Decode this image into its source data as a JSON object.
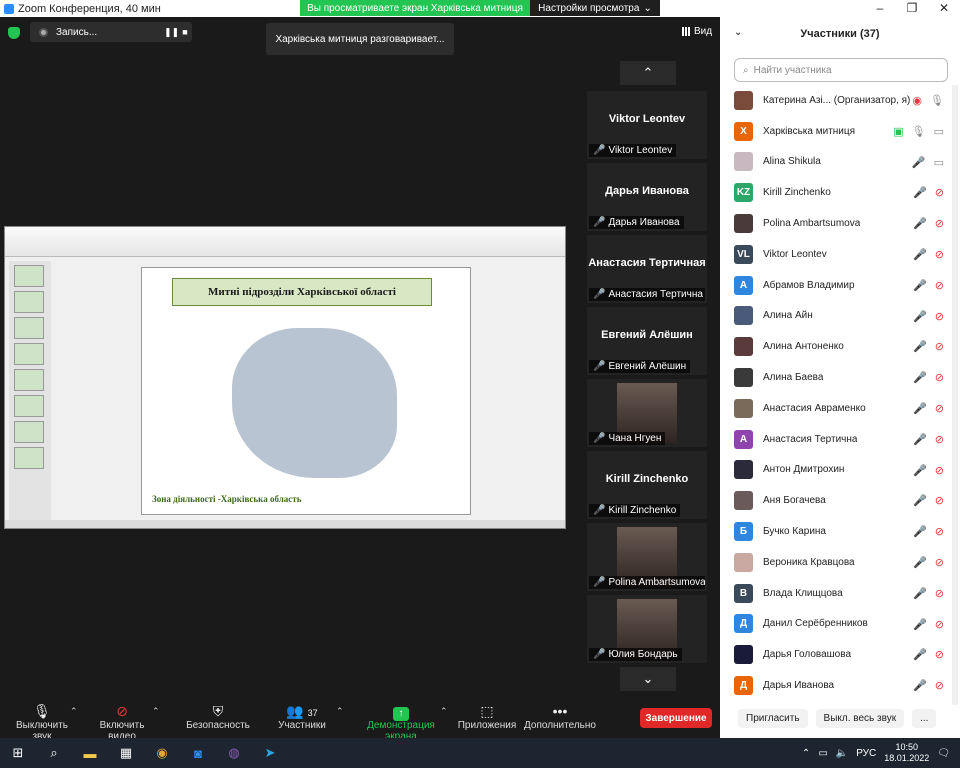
{
  "titlebar": {
    "title": "Zoom Конференция, 40 мин"
  },
  "share_banner": {
    "text": "Вы просматриваете экран Харківська митниця",
    "settings": "Настройки просмотра"
  },
  "recording": {
    "label": "Запись..."
  },
  "talking": {
    "text": "Харківська митниця разговаривает..."
  },
  "view": {
    "label": "Вид"
  },
  "slide": {
    "title": "Митні підрозділи Харківської області",
    "footer": "Зона діяльності -Харківська область"
  },
  "tiles": [
    {
      "name": "Viktor Leontev",
      "label": "Viktor Leontev",
      "video": false
    },
    {
      "name": "Дарья Иванова",
      "label": "Дарья Иванова",
      "video": false
    },
    {
      "name": "Анастасия Тертичная",
      "label": "Анастасия Тертична",
      "video": false
    },
    {
      "name": "Евгений Алёшин",
      "label": "Евгений Алёшин",
      "video": false
    },
    {
      "name": "",
      "label": "Чана Нгуен",
      "video": true
    },
    {
      "name": "Kirill Zinchenko",
      "label": "Kirill Zinchenko",
      "video": false
    },
    {
      "name": "",
      "label": "Polina Ambartsumova",
      "video": true
    },
    {
      "name": "",
      "label": "Юлия Бондарь",
      "video": true
    }
  ],
  "toolbar": {
    "mute": "Выключить звук",
    "video": "Включить видео",
    "security": "Безопасность",
    "participants": "Участники",
    "participants_count": "37",
    "share": "Демонстрация экрана",
    "apps": "Приложения",
    "more": "Дополнительно",
    "end": "Завершение"
  },
  "panel": {
    "title": "Участники (37)",
    "search_placeholder": "Найти участника",
    "invite": "Пригласить",
    "mute_all": "Выкл. весь звук",
    "more": "..."
  },
  "participants": [
    {
      "initials": "",
      "name": "Катерина Азі... (Организатор, я)",
      "color": "#7a4a3a"
    },
    {
      "initials": "Х",
      "name": "Харківська митниця",
      "color": "#e8650a"
    },
    {
      "initials": "",
      "name": "Alina Shikula",
      "color": "#c9b8c0"
    },
    {
      "initials": "KZ",
      "name": "Kirill Zinchenko",
      "color": "#2aa86a"
    },
    {
      "initials": "",
      "name": "Polina Ambartsumova",
      "color": "#4a3a3a"
    },
    {
      "initials": "VL",
      "name": "Viktor Leontev",
      "color": "#3a4a5a"
    },
    {
      "initials": "А",
      "name": "Абрамов Владимир",
      "color": "#2e86de"
    },
    {
      "initials": "",
      "name": "Алина Айн",
      "color": "#4a5a7a"
    },
    {
      "initials": "",
      "name": "Алина Антоненко",
      "color": "#5a3a3a"
    },
    {
      "initials": "",
      "name": "Алина Баева",
      "color": "#3a3a3a"
    },
    {
      "initials": "",
      "name": "Анастасия Авраменко",
      "color": "#7a6a5a"
    },
    {
      "initials": "А",
      "name": "Анастасия Тертична",
      "color": "#8e44ad"
    },
    {
      "initials": "",
      "name": "Антон Дмитрохин",
      "color": "#2a2a3a"
    },
    {
      "initials": "",
      "name": "Аня Богачева",
      "color": "#6a5a5a"
    },
    {
      "initials": "Б",
      "name": "Бучко Карина",
      "color": "#2e86de"
    },
    {
      "initials": "",
      "name": "Вероника Кравцова",
      "color": "#c8a8a0"
    },
    {
      "initials": "В",
      "name": "Влада Клищцова",
      "color": "#3a4a5a"
    },
    {
      "initials": "Д",
      "name": "Данил Серёбренников",
      "color": "#2e86de"
    },
    {
      "initials": "",
      "name": "Дарья Головашова",
      "color": "#1a1a3a"
    },
    {
      "initials": "Д",
      "name": "Дарья Иванова",
      "color": "#e8650a"
    }
  ],
  "taskbar": {
    "lang": "РУС",
    "time": "10:50",
    "date": "18.01.2022"
  }
}
